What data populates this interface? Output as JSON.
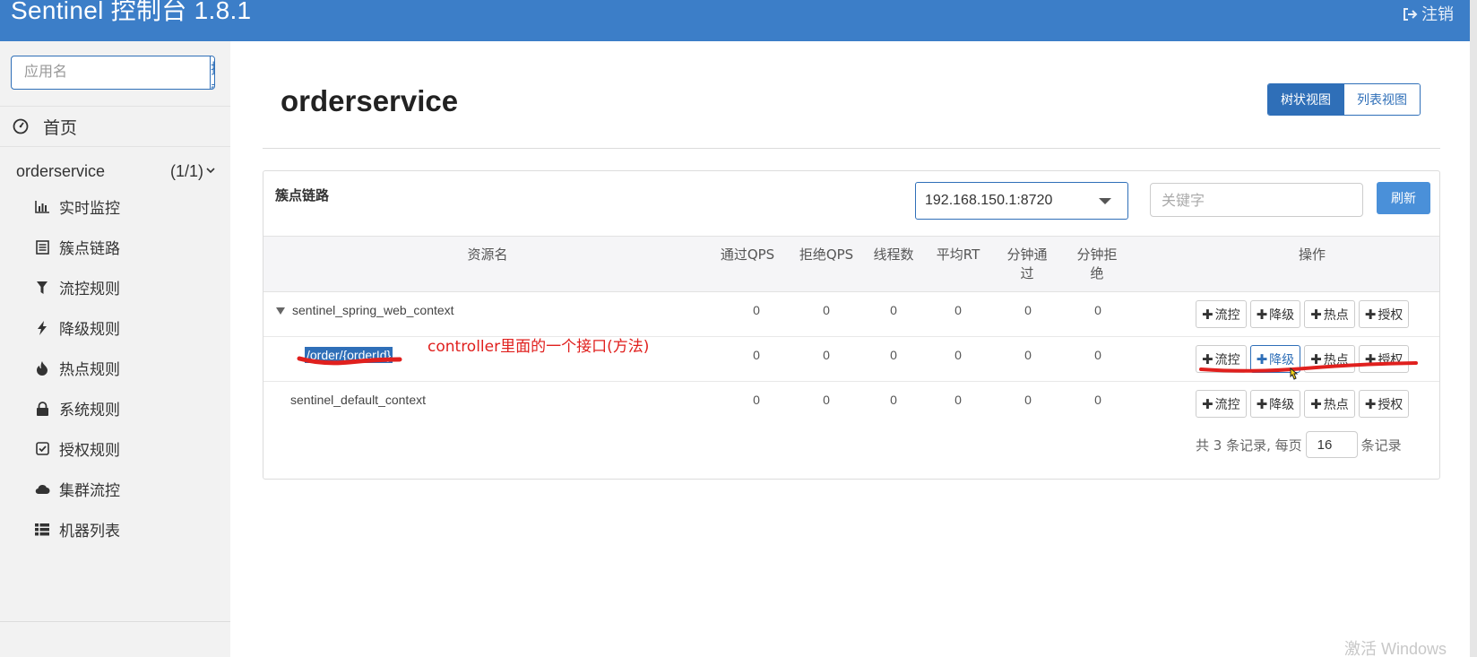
{
  "header": {
    "brand": "Sentinel 控制台 1.8.1",
    "logout_label": "注销",
    "bar_color": "#3c7ec8"
  },
  "sidebar": {
    "search_placeholder": "应用名",
    "search_button": "搜索",
    "home_label": "首页",
    "app": {
      "name": "orderservice",
      "count": "(1/1)"
    },
    "menu": [
      {
        "label": "实时监控",
        "icon": "bar-chart-icon"
      },
      {
        "label": "簇点链路",
        "icon": "list-alt-icon"
      },
      {
        "label": "流控规则",
        "icon": "filter-icon"
      },
      {
        "label": "降级规则",
        "icon": "flash-icon"
      },
      {
        "label": "热点规则",
        "icon": "fire-icon"
      },
      {
        "label": "系统规则",
        "icon": "lock-icon"
      },
      {
        "label": "授权规则",
        "icon": "check-square-icon"
      },
      {
        "label": "集群流控",
        "icon": "cloud-icon"
      },
      {
        "label": "机器列表",
        "icon": "th-list-icon"
      }
    ]
  },
  "main": {
    "title": "orderservice",
    "view_toggle": {
      "tree": "树状视图",
      "list": "列表视图",
      "active": "tree"
    },
    "panel_title": "簇点链路",
    "machine_select": "192.168.150.1:8720",
    "keyword_placeholder": "关键字",
    "refresh_button": "刷新",
    "columns": {
      "resource": "资源名",
      "pass_qps": "通过QPS",
      "block_qps": "拒绝QPS",
      "threads": "线程数",
      "avg_rt": "平均RT",
      "min_pass_l1": "分钟通",
      "min_pass_l2": "过",
      "min_block_l1": "分钟拒",
      "min_block_l2": "绝",
      "ops": "操作"
    },
    "ops_labels": {
      "flow": "流控",
      "degrade": "降级",
      "hot": "热点",
      "auth": "授权"
    },
    "rows": [
      {
        "resource": "sentinel_spring_web_context",
        "pass_qps": "0",
        "block_qps": "0",
        "threads": "0",
        "avg_rt": "0",
        "min_pass": "0",
        "min_block": "0"
      },
      {
        "resource": "/order/{orderId}",
        "pass_qps": "0",
        "block_qps": "0",
        "threads": "0",
        "avg_rt": "0",
        "min_pass": "0",
        "min_block": "0"
      },
      {
        "resource": "sentinel_default_context",
        "pass_qps": "0",
        "block_qps": "0",
        "threads": "0",
        "avg_rt": "0",
        "min_pass": "0",
        "min_block": "0"
      }
    ],
    "pager": {
      "prefix": "共 3 条记录, 每页",
      "page_size": "16",
      "suffix": "条记录"
    }
  },
  "annotation": {
    "text": "controller里面的一个接口(方法)",
    "color": "#e0201e"
  },
  "watermark": "激活 Windows"
}
